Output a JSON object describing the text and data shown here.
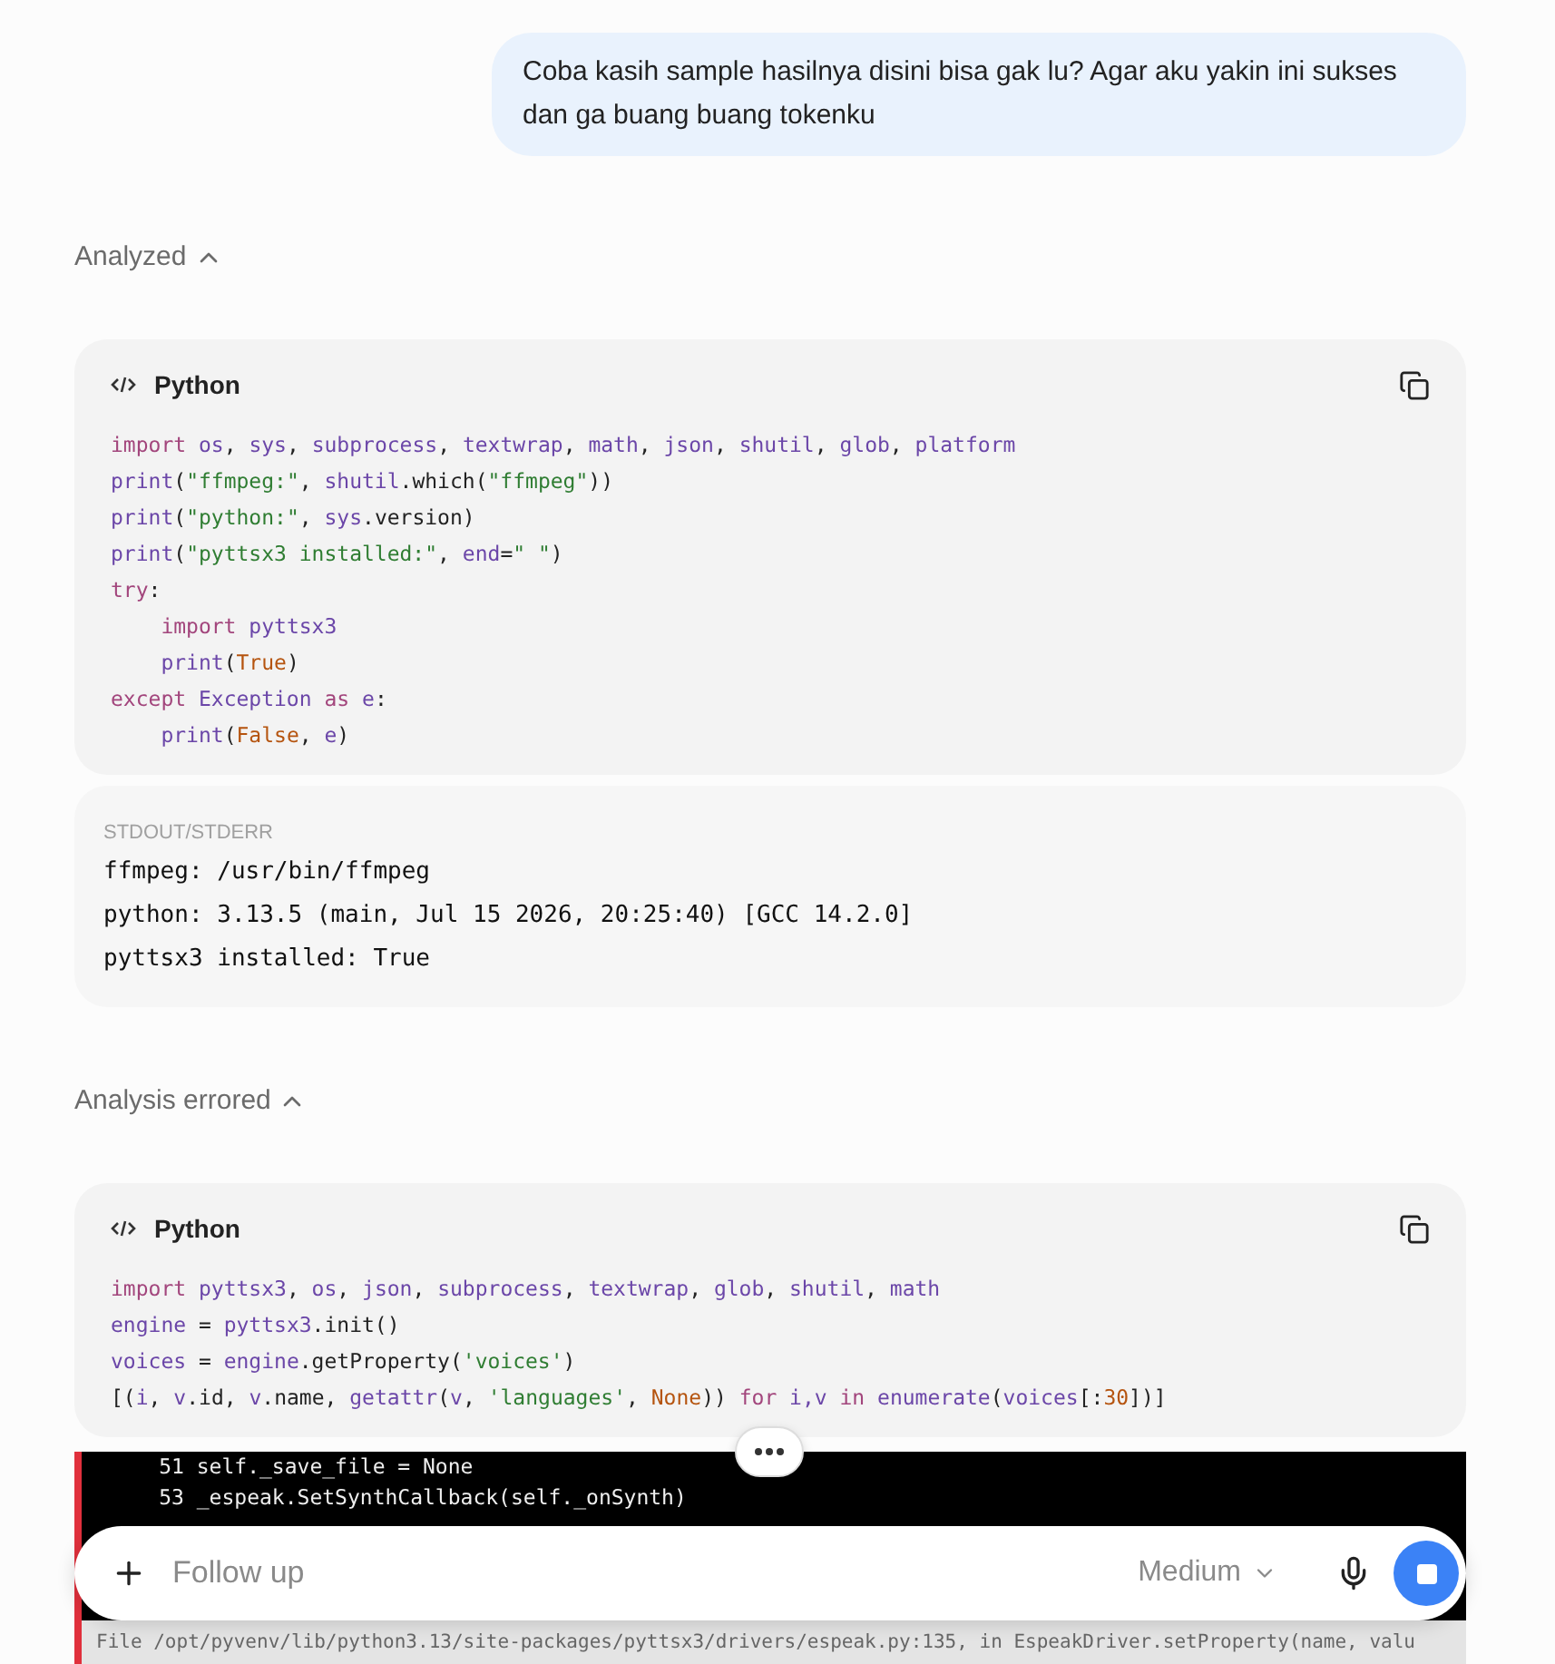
{
  "user_message": "Coba kasih sample hasilnya disini bisa gak lu? Agar aku yakin ini sukses dan ga buang buang tokenku",
  "sections": [
    {
      "status": "Analyzed",
      "expanded": true,
      "code": {
        "language": "Python",
        "lines": [
          [
            {
              "text": "import ",
              "kind": "keyword"
            },
            {
              "text": "os",
              "kind": "ident"
            },
            {
              "text": ", ",
              "kind": "plain"
            },
            {
              "text": "sys",
              "kind": "ident"
            },
            {
              "text": ", ",
              "kind": "plain"
            },
            {
              "text": "subprocess",
              "kind": "ident"
            },
            {
              "text": ", ",
              "kind": "plain"
            },
            {
              "text": "textwrap",
              "kind": "ident"
            },
            {
              "text": ", ",
              "kind": "plain"
            },
            {
              "text": "math",
              "kind": "ident"
            },
            {
              "text": ", ",
              "kind": "plain"
            },
            {
              "text": "json",
              "kind": "ident"
            },
            {
              "text": ", ",
              "kind": "plain"
            },
            {
              "text": "shutil",
              "kind": "ident"
            },
            {
              "text": ", ",
              "kind": "plain"
            },
            {
              "text": "glob",
              "kind": "ident"
            },
            {
              "text": ", ",
              "kind": "plain"
            },
            {
              "text": "platform",
              "kind": "ident"
            }
          ],
          [
            {
              "text": "print",
              "kind": "ident"
            },
            {
              "text": "(",
              "kind": "plain"
            },
            {
              "text": "\"ffmpeg:\"",
              "kind": "string"
            },
            {
              "text": ", ",
              "kind": "plain"
            },
            {
              "text": "shutil",
              "kind": "ident"
            },
            {
              "text": ".which(",
              "kind": "plain"
            },
            {
              "text": "\"ffmpeg\"",
              "kind": "string"
            },
            {
              "text": "))",
              "kind": "plain"
            }
          ],
          [
            {
              "text": "print",
              "kind": "ident"
            },
            {
              "text": "(",
              "kind": "plain"
            },
            {
              "text": "\"python:\"",
              "kind": "string"
            },
            {
              "text": ", ",
              "kind": "plain"
            },
            {
              "text": "sys",
              "kind": "ident"
            },
            {
              "text": ".version)",
              "kind": "plain"
            }
          ],
          [
            {
              "text": "print",
              "kind": "ident"
            },
            {
              "text": "(",
              "kind": "plain"
            },
            {
              "text": "\"pyttsx3 installed:\"",
              "kind": "string"
            },
            {
              "text": ", ",
              "kind": "plain"
            },
            {
              "text": "end",
              "kind": "ident"
            },
            {
              "text": "=",
              "kind": "plain"
            },
            {
              "text": "\" \"",
              "kind": "string"
            },
            {
              "text": ")",
              "kind": "plain"
            }
          ],
          [
            {
              "text": "try",
              "kind": "keyword"
            },
            {
              "text": ":",
              "kind": "plain"
            }
          ],
          [
            {
              "text": "    import ",
              "kind": "keyword"
            },
            {
              "text": "pyttsx3",
              "kind": "ident"
            }
          ],
          [
            {
              "text": "    print",
              "kind": "ident"
            },
            {
              "text": "(",
              "kind": "plain"
            },
            {
              "text": "True",
              "kind": "const"
            },
            {
              "text": ")",
              "kind": "plain"
            }
          ],
          [
            {
              "text": "except ",
              "kind": "keyword"
            },
            {
              "text": "Exception ",
              "kind": "ident"
            },
            {
              "text": "as ",
              "kind": "keyword"
            },
            {
              "text": "e",
              "kind": "ident"
            },
            {
              "text": ":",
              "kind": "plain"
            }
          ],
          [
            {
              "text": "    print",
              "kind": "ident"
            },
            {
              "text": "(",
              "kind": "plain"
            },
            {
              "text": "False",
              "kind": "const"
            },
            {
              "text": ", ",
              "kind": "plain"
            },
            {
              "text": "e",
              "kind": "ident"
            },
            {
              "text": ")",
              "kind": "plain"
            }
          ]
        ]
      },
      "output": {
        "kind": "stdout",
        "label": "STDOUT/STDERR",
        "lines": [
          "ffmpeg: /usr/bin/ffmpeg",
          "python: 3.13.5 (main, Jul 15 2026, 20:25:40) [GCC 14.2.0]",
          "pyttsx3 installed: True"
        ]
      }
    },
    {
      "status": "Analysis errored",
      "expanded": true,
      "code": {
        "language": "Python",
        "lines": [
          [
            {
              "text": "import ",
              "kind": "keyword"
            },
            {
              "text": "pyttsx3",
              "kind": "ident"
            },
            {
              "text": ", ",
              "kind": "plain"
            },
            {
              "text": "os",
              "kind": "ident"
            },
            {
              "text": ", ",
              "kind": "plain"
            },
            {
              "text": "json",
              "kind": "ident"
            },
            {
              "text": ", ",
              "kind": "plain"
            },
            {
              "text": "subprocess",
              "kind": "ident"
            },
            {
              "text": ", ",
              "kind": "plain"
            },
            {
              "text": "textwrap",
              "kind": "ident"
            },
            {
              "text": ", ",
              "kind": "plain"
            },
            {
              "text": "glob",
              "kind": "ident"
            },
            {
              "text": ", ",
              "kind": "plain"
            },
            {
              "text": "shutil",
              "kind": "ident"
            },
            {
              "text": ", ",
              "kind": "plain"
            },
            {
              "text": "math",
              "kind": "ident"
            }
          ],
          [
            {
              "text": "engine",
              "kind": "ident"
            },
            {
              "text": " = ",
              "kind": "plain"
            },
            {
              "text": "pyttsx3",
              "kind": "ident"
            },
            {
              "text": ".init()",
              "kind": "plain"
            }
          ],
          [
            {
              "text": "voices",
              "kind": "ident"
            },
            {
              "text": " = ",
              "kind": "plain"
            },
            {
              "text": "engine",
              "kind": "ident"
            },
            {
              "text": ".getProperty(",
              "kind": "plain"
            },
            {
              "text": "'voices'",
              "kind": "string"
            },
            {
              "text": ")",
              "kind": "plain"
            }
          ],
          [
            {
              "text": "[(",
              "kind": "plain"
            },
            {
              "text": "i",
              "kind": "ident"
            },
            {
              "text": ", ",
              "kind": "plain"
            },
            {
              "text": "v",
              "kind": "ident"
            },
            {
              "text": ".id, ",
              "kind": "plain"
            },
            {
              "text": "v",
              "kind": "ident"
            },
            {
              "text": ".name, ",
              "kind": "plain"
            },
            {
              "text": "getattr",
              "kind": "ident"
            },
            {
              "text": "(",
              "kind": "plain"
            },
            {
              "text": "v",
              "kind": "ident"
            },
            {
              "text": ", ",
              "kind": "plain"
            },
            {
              "text": "'languages'",
              "kind": "string"
            },
            {
              "text": ", ",
              "kind": "plain"
            },
            {
              "text": "None",
              "kind": "const"
            },
            {
              "text": ")) ",
              "kind": "plain"
            },
            {
              "text": "for ",
              "kind": "keyword"
            },
            {
              "text": "i,v ",
              "kind": "ident"
            },
            {
              "text": "in ",
              "kind": "keyword"
            },
            {
              "text": "enumerate",
              "kind": "ident"
            },
            {
              "text": "(",
              "kind": "plain"
            },
            {
              "text": "voices",
              "kind": "ident"
            },
            {
              "text": "[:",
              "kind": "plain"
            },
            {
              "text": "30",
              "kind": "const"
            },
            {
              "text": "])]",
              "kind": "plain"
            }
          ]
        ]
      },
      "output": {
        "kind": "error",
        "lines": [
          "     51 self._save_file = None",
          "     53 _espeak.SetSynthCallback(self._onSynth)"
        ],
        "footer": "File /opt/pyvenv/lib/python3.13/site-packages/pyttsx3/drivers/espeak.py:135, in EspeakDriver.setProperty(name, valu"
      }
    }
  ],
  "composer": {
    "placeholder": "Follow up",
    "model": "Medium",
    "generating": true
  }
}
